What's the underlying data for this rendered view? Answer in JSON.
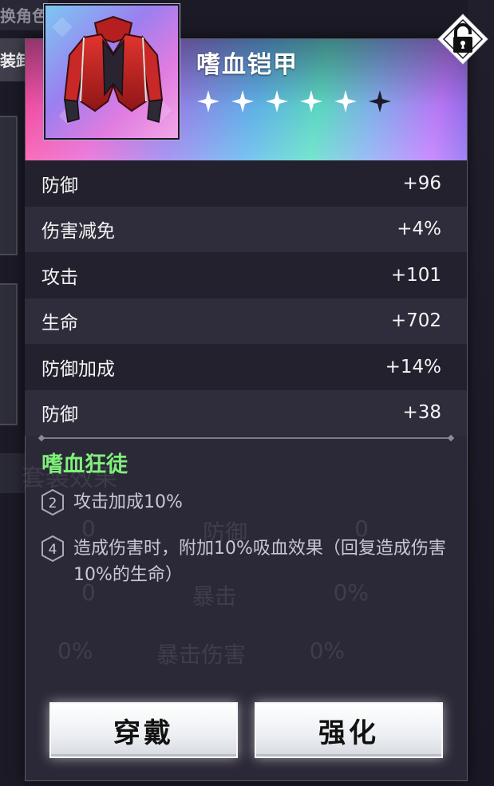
{
  "background": {
    "top_label": "换角色",
    "tab_label": "装卸"
  },
  "item": {
    "name": "嗜血铠甲",
    "stars_filled": 5,
    "stars_total": 6,
    "icon": "red-jacket-armor-icon",
    "lock_icon": "padlock-unlocked-icon"
  },
  "stats": [
    {
      "label": "防御",
      "value": "+96"
    },
    {
      "label": "伤害减免",
      "value": "+4%"
    },
    {
      "label": "攻击",
      "value": "+101"
    },
    {
      "label": "生命",
      "value": "+702"
    },
    {
      "label": "防御加成",
      "value": "+14%"
    },
    {
      "label": "防御",
      "value": "+38"
    }
  ],
  "set": {
    "name": "嗜血狂徒",
    "bonuses": [
      {
        "count": "2",
        "text": "攻击加成10%"
      },
      {
        "count": "4",
        "text": "造成伤害时，附加10%吸血效果（回复造成伤害10%的生命）"
      }
    ]
  },
  "ghost": {
    "set_label": "套装效果",
    "rows": [
      {
        "left": "0",
        "mid": "防御",
        "right": "0"
      },
      {
        "left": "0",
        "mid": "暴击",
        "right": "0%"
      },
      {
        "left": "0%",
        "mid": "暴击伤害",
        "right": "0%"
      }
    ]
  },
  "buttons": {
    "equip": "穿戴",
    "enhance": "强化"
  },
  "colors": {
    "set_name": "#7ff07a",
    "popup_bg": "#2b2937",
    "button_bg": "#ffffff"
  }
}
